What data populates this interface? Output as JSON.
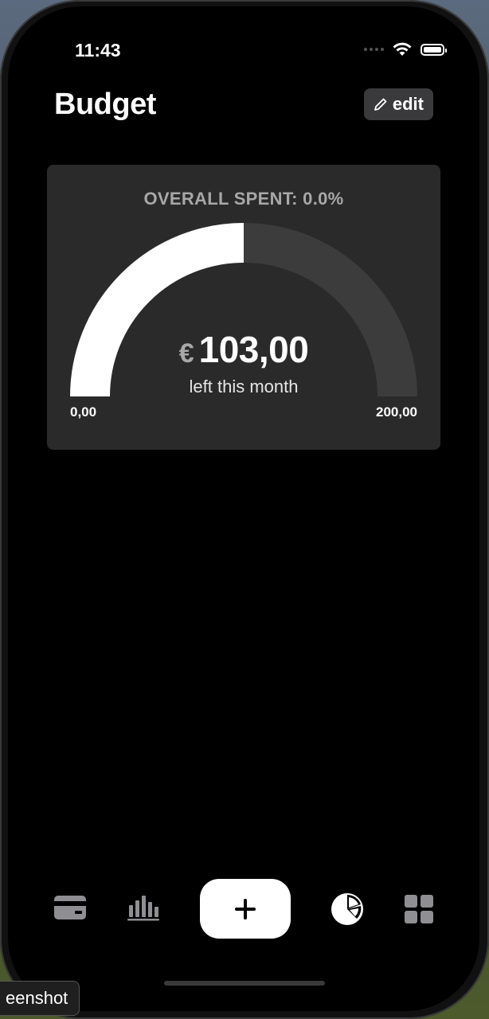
{
  "status_bar": {
    "time": "11:43",
    "icons": [
      "signal-dots-icon",
      "wifi-icon",
      "battery-icon"
    ]
  },
  "header": {
    "title": "Budget",
    "edit_label": "edit",
    "edit_icon": "pencil-icon"
  },
  "budget_card": {
    "title": "OVERALL SPENT: 0.0%",
    "currency": "€",
    "amount_left": "103,00",
    "amount_caption": "left this month",
    "gauge_min": "0,00",
    "gauge_max": "200,00",
    "gauge_fill_fraction": 0.5,
    "fill_color": "#ffffff",
    "track_color": "#3c3c3c"
  },
  "tab_bar": {
    "items": [
      {
        "icon": "card-icon"
      },
      {
        "icon": "bar-chart-icon"
      },
      {
        "icon": "plus-icon"
      },
      {
        "icon": "pie-chart-icon"
      },
      {
        "icon": "grid-icon"
      }
    ]
  },
  "overlay": {
    "tooltip": "eenshot"
  }
}
